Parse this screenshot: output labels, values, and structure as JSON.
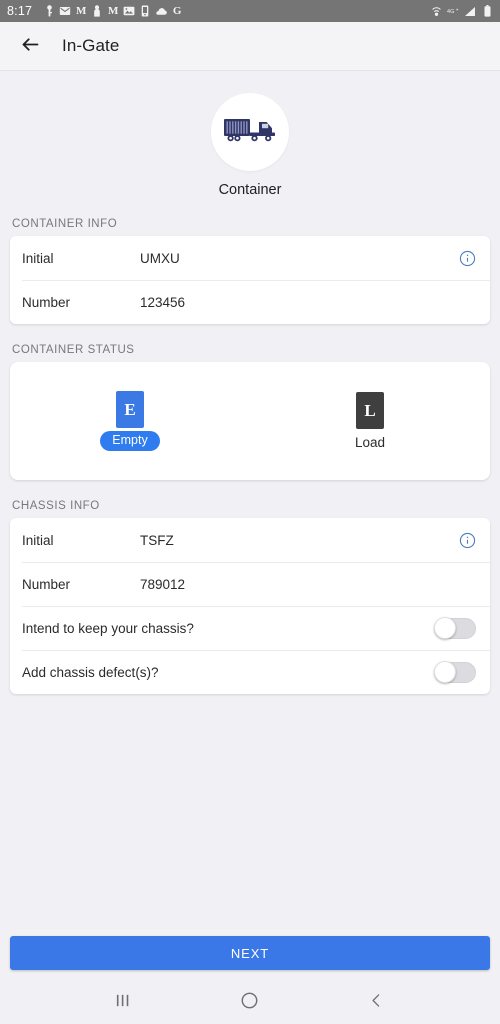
{
  "status_bar": {
    "clock": "8:17",
    "left_icons": [
      "key-icon",
      "mail-icon",
      "gmail-icon",
      "person-icon",
      "gmail-icon",
      "photos-icon",
      "device-icon",
      "cloud-icon",
      "google-g-icon"
    ],
    "right_icons": [
      "vpn-icon",
      "lte-icon",
      "signal-icon",
      "battery-icon"
    ]
  },
  "app_bar": {
    "back_icon": "arrow-left-icon",
    "title": "In-Gate"
  },
  "hero": {
    "icon": "container-truck-icon",
    "label": "Container"
  },
  "container_info": {
    "section_label": "CONTAINER INFO",
    "rows": [
      {
        "label": "Initial",
        "value": "UMXU",
        "has_info_icon": true
      },
      {
        "label": "Number",
        "value": "123456",
        "has_info_icon": false
      }
    ]
  },
  "container_status": {
    "section_label": "CONTAINER STATUS",
    "options": [
      {
        "code": "E",
        "label": "Empty",
        "selected": true
      },
      {
        "code": "L",
        "label": "Load",
        "selected": false
      }
    ]
  },
  "chassis_info": {
    "section_label": "CHASSIS INFO",
    "rows": [
      {
        "label": "Initial",
        "value": "TSFZ"
      },
      {
        "label": "Number",
        "value": "789012"
      }
    ],
    "toggles": [
      {
        "label": "Intend to keep your chassis?",
        "on": false
      },
      {
        "label": "Add chassis defect(s)?",
        "on": false
      }
    ]
  },
  "bottom": {
    "next_label": "NEXT"
  },
  "nav_bar": {
    "recents_icon": "recents-icon",
    "home_icon": "home-icon",
    "back_icon": "back-chevron-icon"
  },
  "colors": {
    "accent_blue": "#3b78e7",
    "pill_blue": "#2f7cf0",
    "load_gray": "#3f3f3f",
    "page_bg": "#f1f1f5",
    "status_bar_bg": "#757575",
    "info_icon_blue": "#4a7fc1"
  }
}
